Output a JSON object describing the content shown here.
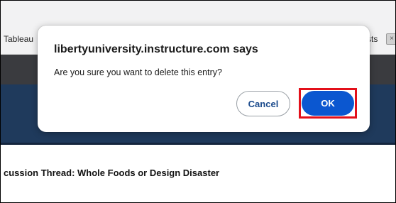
{
  "browser": {
    "bookmarks": {
      "left_label": "Tableau",
      "right_label": "sts",
      "icon": "close-icon"
    }
  },
  "page": {
    "heading": "cussion Thread: Whole Foods or Design Disaster"
  },
  "dialog": {
    "title": "libertyuniversity.instructure.com says",
    "message": "Are you sure you want to delete this entry?",
    "cancel_label": "Cancel",
    "ok_label": "OK"
  },
  "colors": {
    "ok_button": "#0b57d0",
    "highlight_border": "#e3101a",
    "navy_banner": "#1f3a5c",
    "dark_bar": "#3a3b3f"
  }
}
